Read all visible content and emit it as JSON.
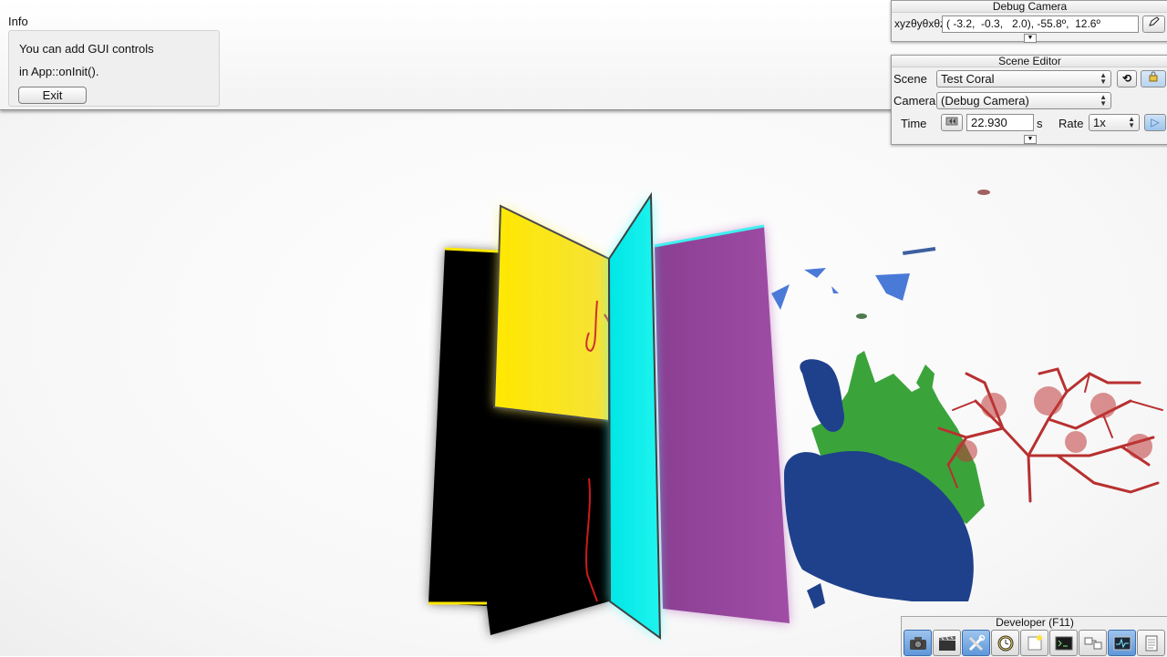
{
  "info": {
    "title": "Info",
    "line1": "You can add GUI controls",
    "line2": "in App::onInit().",
    "exit_label": "Exit"
  },
  "debug_camera": {
    "title": "Debug Camera",
    "coord_label": "xyzθyθxθz",
    "value": "( -3.2,  -0.3,   2.0), -55.8º,  12.6º"
  },
  "scene_editor": {
    "title": "Scene Editor",
    "scene_label": "Scene",
    "scene_value": "Test Coral",
    "camera_label": "Camera",
    "camera_value": "(Debug Camera)",
    "time_label": "Time",
    "time_value": "22.930",
    "time_unit": "s",
    "rate_label": "Rate",
    "rate_value": "1x"
  },
  "developer": {
    "title": "Developer (F11)",
    "tools": [
      "camera-icon",
      "film-clapper-icon",
      "wrench-screwdriver-icon",
      "clock-icon",
      "new-window-icon",
      "terminal-icon",
      "scene-graph-icon",
      "profiler-graph-icon",
      "log-document-icon"
    ]
  },
  "colors": {
    "yellow_panel": "#fff200",
    "cyan_panel": "#00f0ec",
    "magenta_panel": "#9a46a0",
    "black_panel": "#000000",
    "blue_coral": "#1e3f8a",
    "green_coral": "#3aa23a",
    "red_coral": "#b53030"
  }
}
